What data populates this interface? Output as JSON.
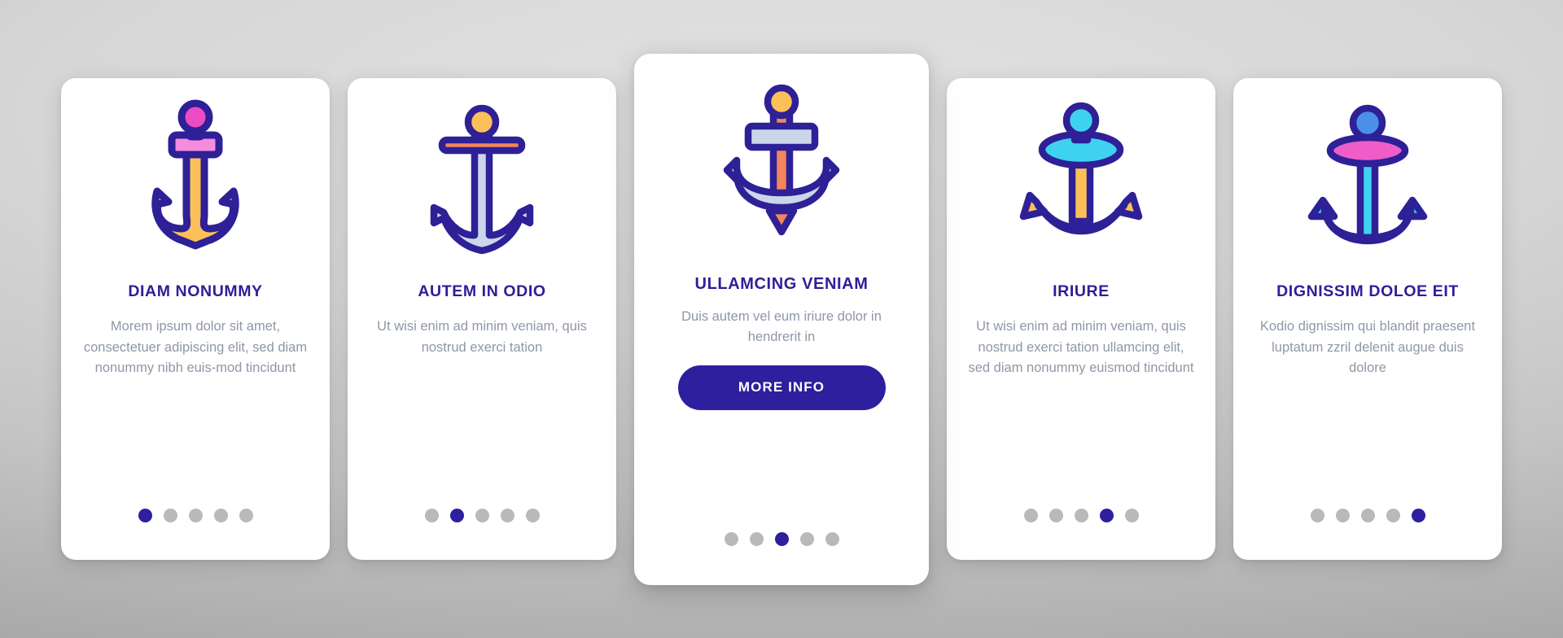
{
  "theme": {
    "background_top": "#e2e2e2",
    "background_bottom": "#a9a9a9",
    "card_background": "#ffffff",
    "title_color": "#2d1f96",
    "body_text_color": "#8e97a8",
    "accent_color": "#2e1f9e",
    "dot_inactive_color": "#b9b9b9",
    "outline_color": "#2e2096",
    "yellow": "#fcc455",
    "orange": "#f7995c",
    "pink": "#f472d8",
    "magenta": "#ec4bc4",
    "cyan": "#3fd2f0",
    "blue": "#4a8fe8",
    "steel": "#ccd6ea"
  },
  "screens": [
    {
      "icon_name": "anchor-icon-magenta-yellow",
      "title": "DIAM NONUMMY",
      "body": "Morem ipsum dolor sit amet, consectetuer adipiscing elit, sed diam nonummy nibh euis-mod tincidunt",
      "dots_total": 5,
      "dot_active_index": 1,
      "has_button": false
    },
    {
      "icon_name": "anchor-icon-yellow-steel",
      "title": "AUTEM IN ODIO",
      "body": "Ut wisi enim ad minim veniam, quis nostrud exerci tation",
      "dots_total": 5,
      "dot_active_index": 2,
      "has_button": false
    },
    {
      "icon_name": "anchor-icon-orange-steel",
      "title": "ULLAMCING VENIAM",
      "body": "Duis autem vel eum iriure dolor in hendrerit in",
      "button_label": "MORE INFO",
      "dots_total": 5,
      "dot_active_index": 3,
      "has_button": true
    },
    {
      "icon_name": "anchor-icon-cyan-yellow",
      "title": "IRIURE",
      "body": "Ut wisi enim ad minim veniam, quis nostrud exerci tation ullamcing elit, sed diam nonummy euismod tincidunt",
      "dots_total": 5,
      "dot_active_index": 4,
      "has_button": false
    },
    {
      "icon_name": "anchor-icon-pink-cyan",
      "title": "DIGNISSIM DOLOE EIT",
      "body": "Kodio dignissim qui blandit praesent luptatum zzril delenit augue duis dolore",
      "dots_total": 5,
      "dot_active_index": 5,
      "has_button": false
    }
  ]
}
